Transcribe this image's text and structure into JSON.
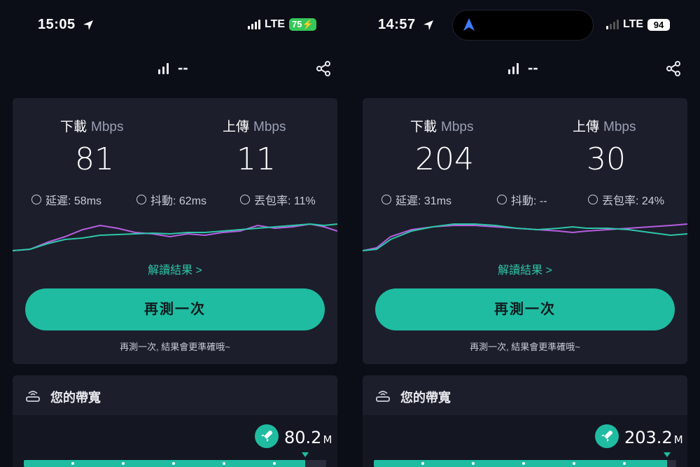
{
  "colors": {
    "accent": "#1fbca1",
    "download_line": "#b65fe0",
    "upload_line": "#2dc6a8",
    "card_bg": "#1c1e2b",
    "page_bg": "#0b0d17"
  },
  "panels": [
    {
      "status": {
        "time": "15:05",
        "network": "LTE",
        "battery": "75",
        "battery_charging": true,
        "battery_color": "#34c759"
      },
      "header": {
        "network_label": "--"
      },
      "download": {
        "label": "下載",
        "unit": "Mbps",
        "value": "81"
      },
      "upload": {
        "label": "上傳",
        "unit": "Mbps",
        "value": "11"
      },
      "stats": {
        "latency": "延遲: 58ms",
        "jitter": "抖動: 62ms",
        "loss": "丟包率: 11%"
      },
      "result_link": "解讀結果 >",
      "retest_button": "再測一次",
      "hint": "再測一次, 結果會更準確哦~",
      "bandwidth": {
        "title": "您的帶寬",
        "value": "80.2",
        "unit": "M",
        "fill_fraction": 0.93
      }
    },
    {
      "status": {
        "time": "14:57",
        "network": "LTE",
        "battery": "94",
        "battery_charging": false,
        "battery_color": "#ffffff"
      },
      "header": {
        "network_label": "--"
      },
      "download": {
        "label": "下載",
        "unit": "Mbps",
        "value": "204"
      },
      "upload": {
        "label": "上傳",
        "unit": "Mbps",
        "value": "30"
      },
      "stats": {
        "latency": "延遲: 31ms",
        "jitter": "抖動: --",
        "loss": "丟包率: 24%"
      },
      "result_link": "解讀結果 >",
      "retest_button": "再測一次",
      "hint": "再測一次, 結果會更準確哦~",
      "bandwidth": {
        "title": "您的帶寬",
        "value": "203.2",
        "unit": "M",
        "fill_fraction": 0.97
      }
    }
  ]
}
